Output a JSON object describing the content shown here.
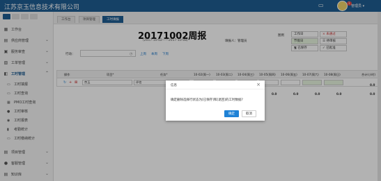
{
  "app": {
    "title": "江苏京玉信息技术有限公司",
    "user": "管理员",
    "msg_count": "1"
  },
  "sidebar": {
    "items": [
      {
        "label": "工作台",
        "icon": "dashboard-icon"
      },
      {
        "label": "供应商管理",
        "icon": "supplier-icon"
      },
      {
        "label": "服务审查",
        "icon": "review-icon"
      },
      {
        "label": "工单管理",
        "icon": "ticket-icon"
      },
      {
        "label": "工时管理",
        "icon": "timesheet-icon"
      }
    ],
    "sub_items": [
      {
        "label": "工时填报",
        "icon": "fill-icon"
      },
      {
        "label": "工时查询",
        "icon": "query-icon"
      },
      {
        "label": "PMO工时查询",
        "icon": "grid-icon"
      },
      {
        "label": "工时审核",
        "icon": "audit-icon"
      },
      {
        "label": "工时报表",
        "icon": "report-icon"
      },
      {
        "label": "考勤统计",
        "icon": "stats-icon"
      },
      {
        "label": "工时缴纳统计",
        "icon": "pay-icon"
      }
    ],
    "bottom_items": [
      {
        "label": "项目管理",
        "icon": "project-icon"
      },
      {
        "label": "客服管理",
        "icon": "customer-icon"
      },
      {
        "label": "知识库",
        "icon": "knowledge-icon"
      }
    ]
  },
  "tabs": [
    "工作台",
    "项目管理",
    "工时填报"
  ],
  "page": {
    "title": "20171002周报",
    "dates": "(2017-10-02——2017-10-08)",
    "filled_by": "填报人：管理员",
    "legend_title": "图例",
    "legend": [
      "工作日",
      "未通过",
      "节假日",
      "待审核",
      "已保存",
      "已批准"
    ],
    "search_label": "行动：",
    "nav": [
      "上周",
      "本周",
      "下周"
    ]
  },
  "table": {
    "headers": [
      "操作",
      "项目*",
      "任务*",
      "10-02(周一)",
      "10-03(周二)",
      "10-04(周三)",
      "10-05(周四)",
      "10-06(周五)",
      "10-07(周六)",
      "10-08(周日)",
      "合计(小时)"
    ],
    "row": {
      "project": "京玉",
      "task": "评估",
      "total": "0.0"
    },
    "totals": [
      "0.0",
      "0.0",
      "0.0",
      "0.0",
      "0.0",
      "0.0",
      "0.0",
      "0.0"
    ]
  },
  "dialog": {
    "title": "信息",
    "message": "确定删除选择行状态为[已保存]和[退回]的工时数据?",
    "ok": "确定",
    "cancel": "取消"
  },
  "colors": {
    "brand": "#1f5d92",
    "holiday": "#e8f6e0",
    "ok_button": "#1f82d6"
  }
}
